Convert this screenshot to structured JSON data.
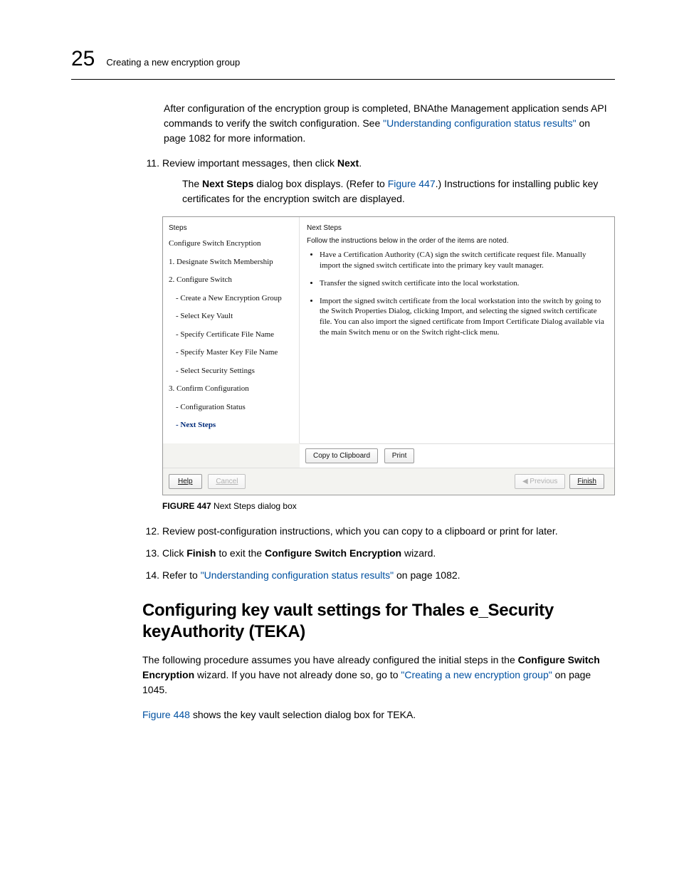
{
  "header": {
    "chapter_number": "25",
    "chapter_title": "Creating a new encryption group"
  },
  "intro": {
    "p1a": "After configuration of the encryption group is completed, BNAthe Management application sends API commands to verify the switch configuration. See ",
    "p1link": "\"Understanding configuration status results\"",
    "p1b": " on page 1082 for more information."
  },
  "steps": {
    "s11_num": "11.",
    "s11_text_a": "Review important messages, then click ",
    "s11_text_bold": "Next",
    "s11_text_b": ".",
    "s11_sub_a": "The ",
    "s11_sub_bold": "Next Steps",
    "s11_sub_b": " dialog box displays. (Refer to ",
    "s11_sub_link": "Figure 447",
    "s11_sub_c": ".) Instructions for installing public key certificates for the encryption switch are displayed.",
    "s12_num": "12.",
    "s12_text": "Review post-configuration instructions, which you can copy to a clipboard or print for later.",
    "s13_num": "13.",
    "s13_a": "Click ",
    "s13_b1": "Finish",
    "s13_b": " to exit the ",
    "s13_b2": "Configure Switch Encryption",
    "s13_c": " wizard.",
    "s14_num": "14.",
    "s14_a": "Refer to ",
    "s14_link": "\"Understanding configuration status results\"",
    "s14_b": " on page 1082."
  },
  "dialog": {
    "steps_title": "Steps",
    "ns_title": "Next Steps",
    "steps_list": [
      "Configure Switch Encryption",
      "1. Designate Switch Membership",
      "2. Configure Switch",
      "   - Create a New Encryption Group",
      "   - Select Key Vault",
      "   - Specify Certificate File Name",
      "   - Specify Master Key File Name",
      "   - Select Security Settings",
      "3. Confirm Configuration",
      "   - Configuration Status",
      "   - Next Steps"
    ],
    "instruction": "Follow the instructions below in the order of the items are noted.",
    "bullets": [
      "Have a Certification Authority (CA) sign the switch certificate request file. Manually import the signed switch certificate into the primary key vault manager.",
      "Transfer the signed switch certificate into the local workstation.",
      "Import the signed switch certificate from the local workstation into the switch by going to the Switch Properties Dialog, clicking Import, and selecting the signed switch certificate file. You can also import the signed certificate from Import Certificate Dialog available via the main Switch menu or on the Switch right-click menu."
    ],
    "btn_copy": "Copy to Clipboard",
    "btn_print": "Print",
    "btn_help": "Help",
    "btn_cancel": "Cancel",
    "btn_prev": "Previous",
    "btn_finish": "Finish"
  },
  "caption": {
    "label": "FIGURE 447",
    "text": "   Next Steps dialog box"
  },
  "section": {
    "h2": "Configuring key vault settings for Thales e_Security keyAuthority (TEKA)",
    "p1a": "The following procedure assumes you have already configured the initial steps in the ",
    "p1b1": "Configure Switch Encryption",
    "p1b": " wizard. If you have not already done so, go to ",
    "p1link": "\"Creating a new encryption group\"",
    "p1c": " on page 1045.",
    "p2link": "Figure 448",
    "p2b": " shows the key vault selection dialog box for TEKA."
  }
}
